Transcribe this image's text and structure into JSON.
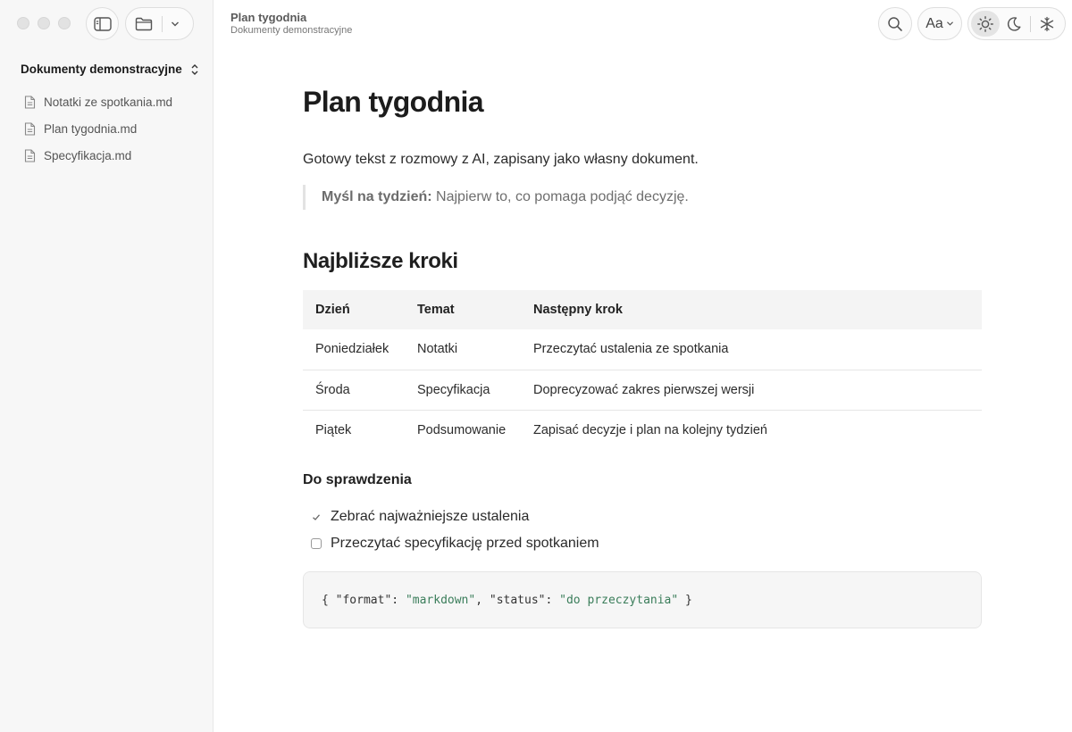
{
  "header": {
    "title": "Plan tygodnia",
    "subtitle": "Dokumenty demonstracyjne",
    "font_button_label": "Aa"
  },
  "sidebar": {
    "workspace_title": "Dokumenty demonstracyjne",
    "files": [
      {
        "name": "Notatki ze spotkania.md",
        "icon": "file-icon"
      },
      {
        "name": "Plan tygodnia.md",
        "icon": "file-icon"
      },
      {
        "name": "Specyfikacja.md",
        "icon": "file-icon"
      }
    ]
  },
  "document": {
    "title": "Plan tygodnia",
    "intro": "Gotowy tekst z rozmowy z AI, zapisany jako własny dokument.",
    "quote": {
      "label": "Myśl na tydzień:",
      "text": " Najpierw to, co pomaga podjąć decyzję."
    },
    "section_heading": "Najbliższe kroki",
    "table": {
      "headers": [
        "Dzień",
        "Temat",
        "Następny krok"
      ],
      "rows": [
        [
          "Poniedziałek",
          "Notatki",
          "Przeczytać ustalenia ze spotkania"
        ],
        [
          "Środa",
          "Specyfikacja",
          "Doprecyzować zakres pierwszej wersji"
        ],
        [
          "Piątek",
          "Podsumowanie",
          "Zapisać decyzje i plan na kolejny tydzień"
        ]
      ]
    },
    "checklist_heading": "Do sprawdzenia",
    "checklist": [
      {
        "text": "Zebrać najważniejsze ustalenia",
        "checked": true
      },
      {
        "text": "Przeczytać specyfikację przed spotkaniem",
        "checked": false
      }
    ],
    "code": {
      "open": "{ ",
      "k1": "\"format\"",
      "sep1": ": ",
      "v1": "\"markdown\"",
      "comma": ", ",
      "k2": "\"status\"",
      "sep2": ": ",
      "v2": "\"do przeczytania\"",
      "close": " }"
    }
  },
  "colors": {
    "sidebar_bg": "#f7f7f7",
    "code_string": "#3a7d5a",
    "table_header_bg": "#f4f4f4"
  }
}
